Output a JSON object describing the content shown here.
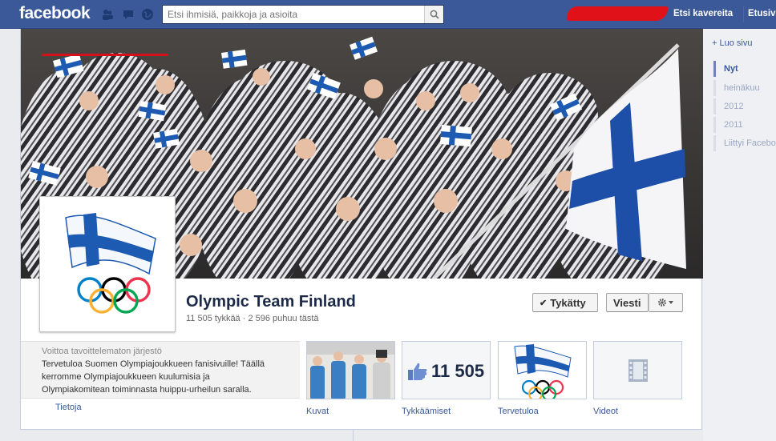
{
  "topbar": {
    "logo": "facebook",
    "search_placeholder": "Etsi ihmisiä, paikkoja ja asioita",
    "find_friends": "Etsi kavereita",
    "home": "Etusivu"
  },
  "sidebar": {
    "create_page": "+ Luo sivu",
    "timeline": [
      "Nyt",
      "heinäkuu",
      "2012",
      "2011",
      "Liittyi Facebookiin"
    ]
  },
  "page": {
    "title": "Olympic Team Finland",
    "stats": "11 505 tykkää · 2 596 puhuu tästä",
    "like_button": "Tykätty",
    "message_button": "Viesti",
    "category": "Voittoa tavoittelematon järjestö",
    "description": "Tervetuloa Suomen Olympiajoukkueen fanisivuille! Täällä kerromme Olympiajoukkueen kuulumisia ja Olympiakomitean toiminnasta huippu-urheilun saralla.",
    "about_link": "Tietoja"
  },
  "tiles": {
    "photos": "Kuvat",
    "likes": "Tykkäämiset",
    "likes_count": "11 505",
    "welcome": "Tervetuloa",
    "videos": "Videot"
  },
  "colors": {
    "brand": "#3b5998",
    "finland_blue": "#1d5ab2",
    "olympic_rings": [
      "#0081c8",
      "#fcb131",
      "#000000",
      "#00a651",
      "#ee334e"
    ]
  }
}
